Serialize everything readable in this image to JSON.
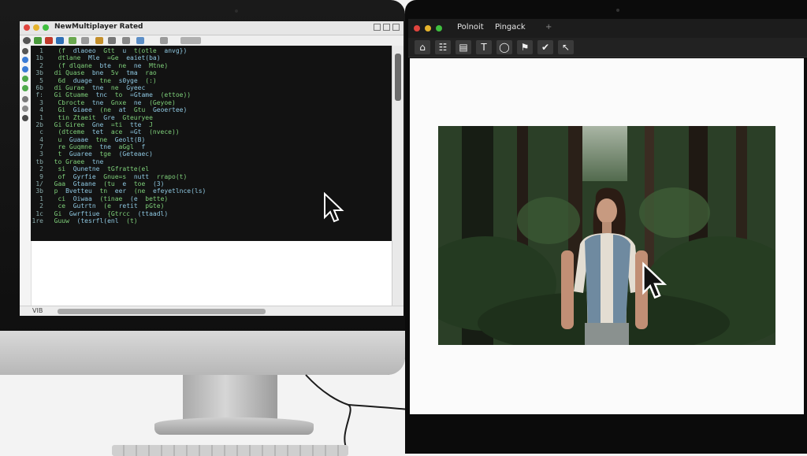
{
  "left_screen": {
    "window_title": "NewMultiplayer Rated",
    "status_text": "VIB",
    "code_lines": [
      "1   (f  dlaoeo  Gtt  u  t(otle  anvg})",
      "1b   dtlane  Mle  =Ge  eaiet(ba)",
      "2   (f dlqane  bte  ne  ne  Mtne)",
      "3b  di Quase  bne  5v  tma  rao",
      "5   6d  duage  tne  s0yge  (:)",
      "6b  di Gurae  tne  ne  Gyeec",
      "f:  Gi Gtuame  tnc  to  =Gtame  (ettoe))",
      "3   Cbrocte  tne  Gnxe  ne  (Geyoe)",
      "4   Gi  Giaee  (ne  at  Gtu  Geoertee)",
      "1   tin Ztaeit  Gre  Gteuryee",
      "2b  Gi Giree  Gne  =ti  tte  J",
      "c   (dtceme  tet  ace  =Gt  (nvece))",
      "4   u  Guaae  tne  Geolt(B)",
      "7   re Guqmne  tne  aGgl  f",
      "3   t  Guaree  tge  (Geteaec)",
      "tb  to Graee  tne",
      "2   si  Qunetne  tGfratte(el",
      "9   of  Gyrfie  Gnue=s  nutt  rrapo(t)",
      "1/  Gaa  Gtaane  (tu  e  toe  (3)",
      "3b  p  Bvetteu  tn  eer  (ne  efeyetlnce(ls)",
      "1   ci  Oiwaa  (tinae  (e  bette)",
      "2   ce  Gutrtn  (e  retit  pGte)",
      "1c  Gi  Gwrftiue  {Gtrcc  (ttaadl)",
      "1re  Guuw  (tesrfl(enl  (t)"
    ]
  },
  "right_screen": {
    "tabs": [
      "Polnoit",
      "Pingack",
      "+"
    ],
    "tools": [
      {
        "icon": "home-icon",
        "glyph": "⌂"
      },
      {
        "icon": "grid-icon",
        "glyph": "☷"
      },
      {
        "icon": "layout-icon",
        "glyph": "▤"
      },
      {
        "icon": "text-tool-icon",
        "glyph": "T"
      },
      {
        "icon": "speech-icon",
        "glyph": "◯"
      },
      {
        "icon": "stamp-icon",
        "glyph": "⚑"
      },
      {
        "icon": "check-icon",
        "glyph": "✔"
      },
      {
        "icon": "pointer-tool-icon",
        "glyph": "↖"
      }
    ]
  },
  "colors": {
    "bezel": "#0b0b0b",
    "code_background": "#121212",
    "code_green": "#7fd07a",
    "forest_dark": "#1f2f1c",
    "traffic_red": "#e0443e",
    "traffic_yellow": "#e5b32c",
    "traffic_green": "#3fbf3f"
  }
}
